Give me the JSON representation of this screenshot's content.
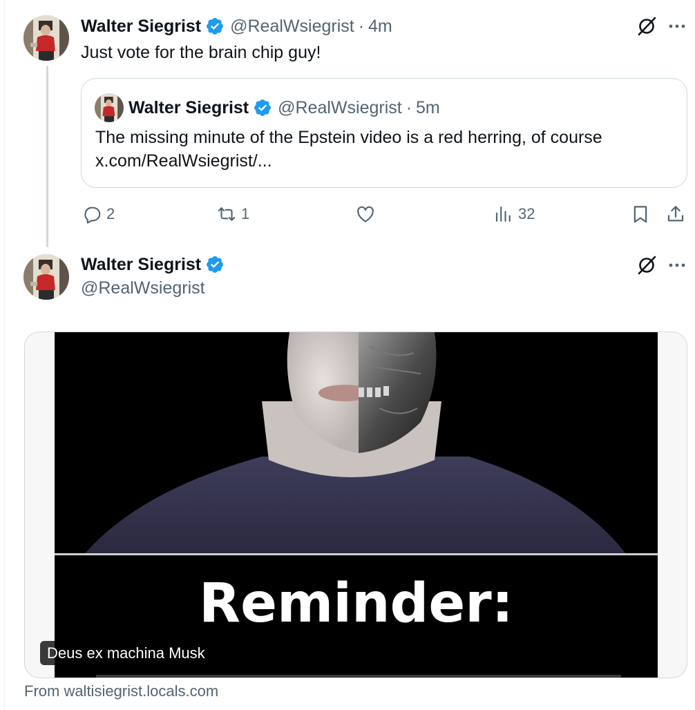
{
  "colors": {
    "verified": "#1d9bf0",
    "muted": "#536471",
    "border": "#cfd9de"
  },
  "tweet1": {
    "author_name": "Walter Siegrist",
    "handle": "@RealWsiegrist",
    "separator": "·",
    "time": "4m",
    "text": "Just vote for the brain chip guy!",
    "quote": {
      "author_name": "Walter Siegrist",
      "handle": "@RealWsiegrist",
      "separator": "·",
      "time": "5m",
      "text_line1": "The missing minute of the Epstein video is a red herring, of course",
      "text_line2": "x.com/RealWsiegrist/..."
    },
    "actions": {
      "replies": "2",
      "reposts": "1",
      "likes": "",
      "views": "32"
    },
    "icons": [
      "reply-icon",
      "repost-icon",
      "like-icon",
      "views-icon",
      "bookmark-icon",
      "share-icon",
      "grok-icon",
      "more-icon"
    ]
  },
  "tweet2": {
    "author_name": "Walter Siegrist",
    "handle": "@RealWsiegrist",
    "card": {
      "image_text": "Reminder:",
      "caption": "Deus ex machina Musk",
      "source": "From waltisiegrist.locals.com"
    }
  }
}
